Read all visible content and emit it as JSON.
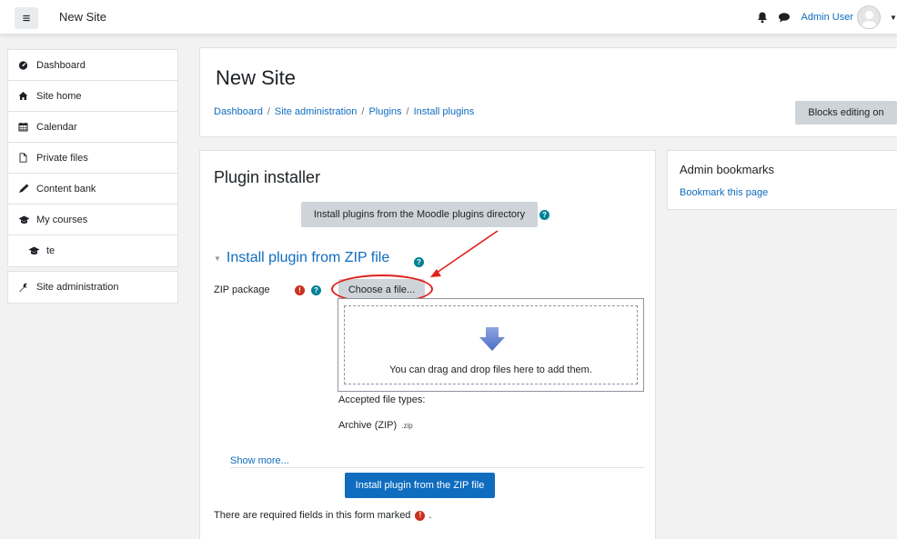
{
  "navbar": {
    "menu_icon": "hamburger-icon",
    "site_name": "New Site",
    "user_name": "Admin User",
    "icons": [
      "bell-icon",
      "chat-icon",
      "avatar",
      "caret-down-icon"
    ]
  },
  "sidebar": {
    "items": [
      {
        "label": "Dashboard",
        "icon": "dashboard-icon"
      },
      {
        "label": "Site home",
        "icon": "home-icon"
      },
      {
        "label": "Calendar",
        "icon": "calendar-icon"
      },
      {
        "label": "Private files",
        "icon": "file-icon"
      },
      {
        "label": "Content bank",
        "icon": "pencil-icon"
      },
      {
        "label": "My courses",
        "icon": "graduation-cap-icon"
      },
      {
        "label": "te",
        "icon": "graduation-cap-icon"
      }
    ],
    "admin_item": {
      "label": "Site administration",
      "icon": "wrench-icon"
    }
  },
  "header": {
    "title": "New Site",
    "breadcrumb": [
      "Dashboard",
      "Site administration",
      "Plugins",
      "Install plugins"
    ],
    "blocks_editing_button": "Blocks editing on"
  },
  "main": {
    "title": "Plugin installer",
    "directory_button": "Install plugins from the Moodle plugins directory",
    "section_title": "Install plugin from ZIP file",
    "zip_label": "ZIP package",
    "choose_button": "Choose a file...",
    "drop_text": "You can drag and drop files here to add them.",
    "accepted_label": "Accepted file types:",
    "archive_label": "Archive (ZIP)",
    "archive_ext": ".zip",
    "show_more": "Show more...",
    "install_button": "Install plugin from the ZIP file",
    "required_note": "There are required fields in this form marked",
    "required_note_end": "."
  },
  "bookmarks": {
    "title": "Admin bookmarks",
    "link": "Bookmark this page"
  },
  "colors": {
    "link": "#0f6cbf",
    "primary_button": "#0f6cbf",
    "secondary_button": "#ced4da",
    "help_icon": "#008196",
    "required_icon": "#ca3120",
    "annotation": "#e0211c"
  }
}
